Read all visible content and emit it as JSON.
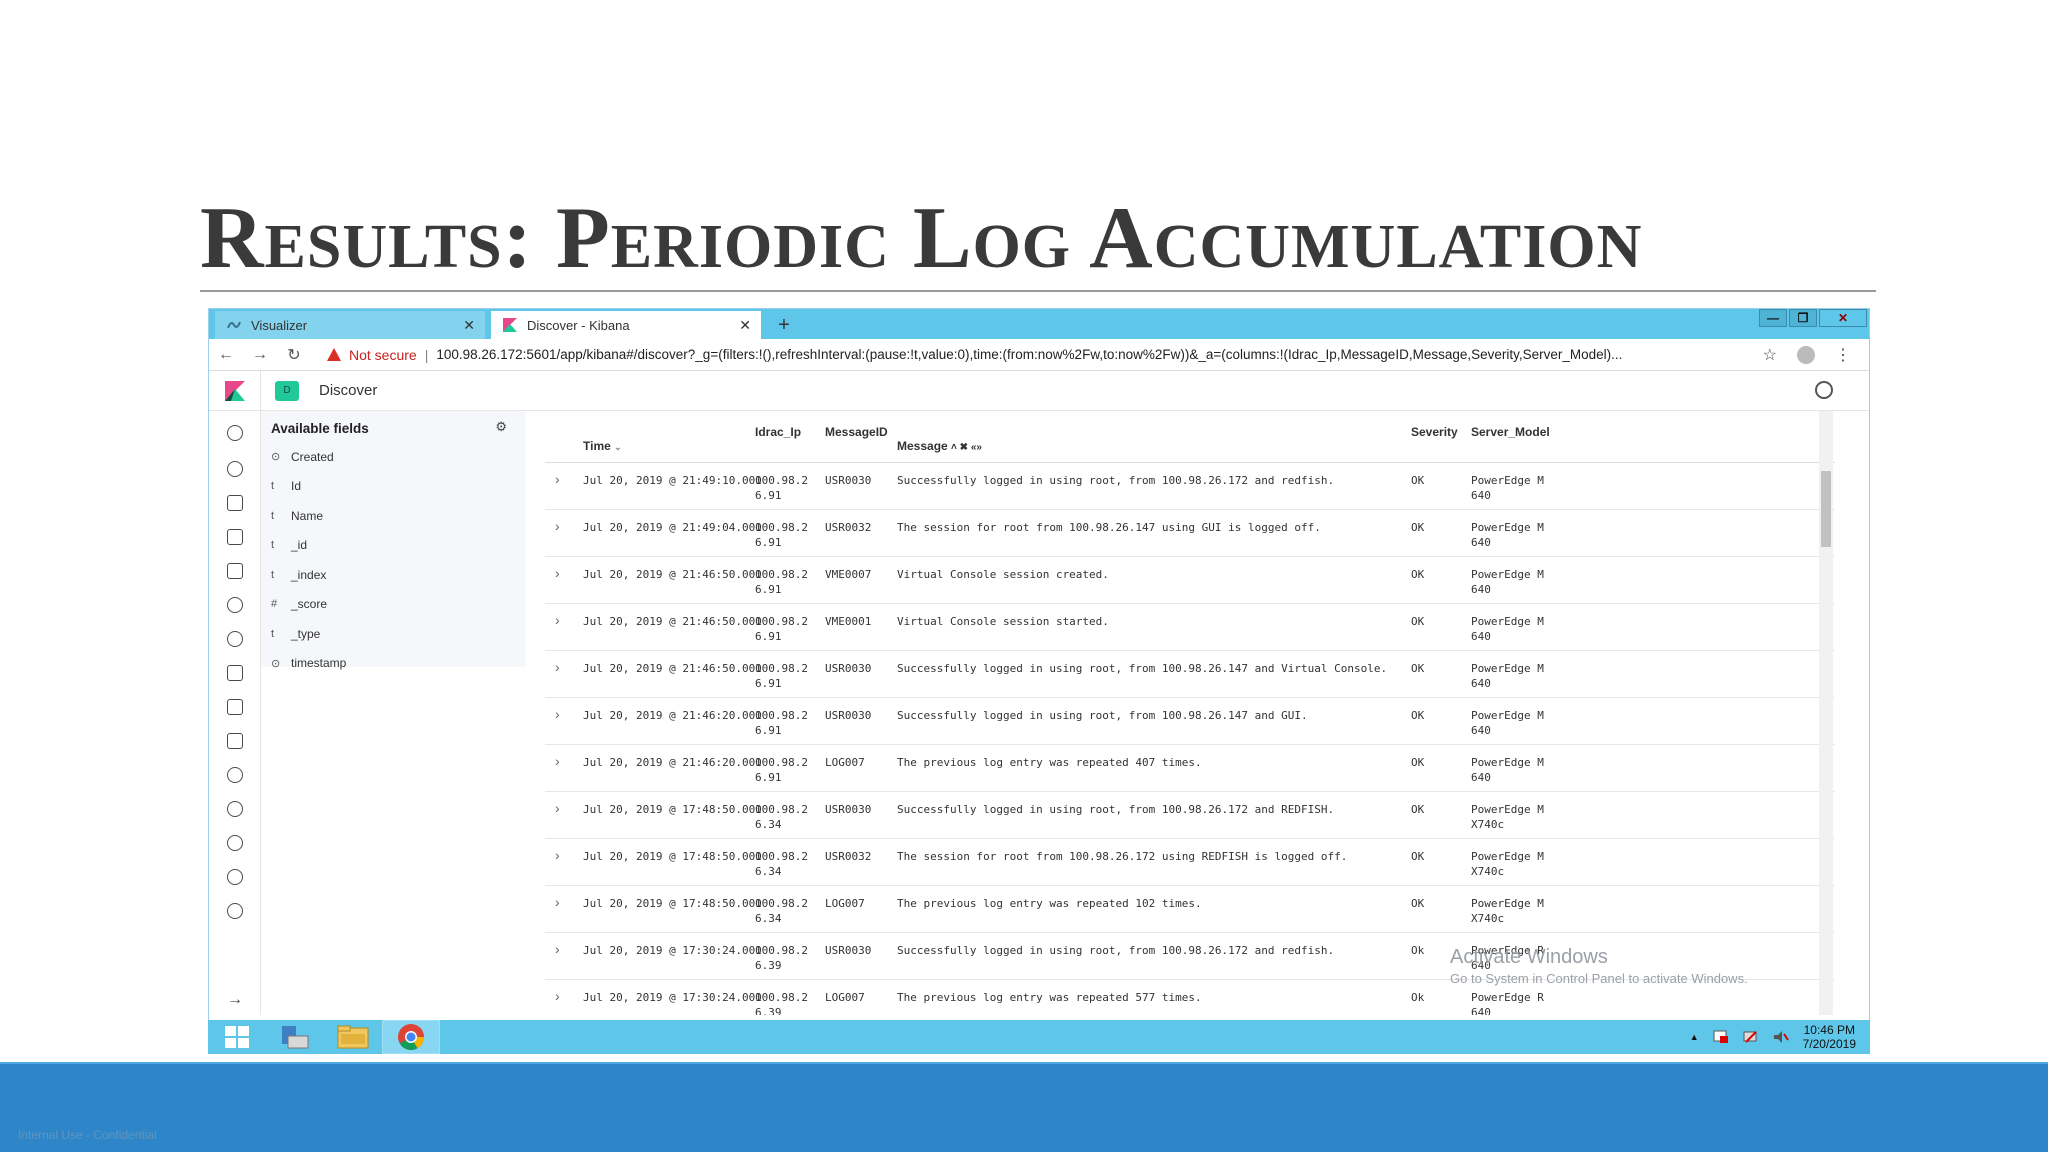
{
  "slide": {
    "title": "Results: Periodic Log Accumulation",
    "footer_note": "Internal Use - Confidential"
  },
  "browser": {
    "tabs": [
      {
        "label": "Visualizer",
        "active": false
      },
      {
        "label": "Discover - Kibana",
        "active": true
      }
    ],
    "new_tab": "+",
    "window_controls": {
      "minimize": "—",
      "restore": "❐",
      "close": "✕"
    },
    "nav": {
      "back": "←",
      "forward": "→",
      "reload": "↻"
    },
    "security_label": "Not secure",
    "separator": "|",
    "url": "100.98.26.172:5601/app/kibana#/discover?_g=(filters:!(),refreshInterval:(pause:!t,value:0),time:(from:now%2Fw,to:now%2Fw))&_a=(columns:!(Idrac_Ip,MessageID,Message,Severity,Server_Model)...",
    "bookmark": "☆",
    "menu": "⋮"
  },
  "kibana": {
    "space_badge": "D",
    "breadcrumb": "Discover",
    "sidebar": {
      "title": "Available fields",
      "gear": "⚙",
      "fields": [
        {
          "type": "⊙",
          "name": "Created"
        },
        {
          "type": "t",
          "name": "Id"
        },
        {
          "type": "t",
          "name": "Name"
        },
        {
          "type": "t",
          "name": "_id"
        },
        {
          "type": "t",
          "name": "_index"
        },
        {
          "type": "#",
          "name": "_score"
        },
        {
          "type": "t",
          "name": "_type"
        },
        {
          "type": "⊙",
          "name": "timestamp"
        }
      ]
    },
    "table": {
      "headers": {
        "time": "Time",
        "idrac_ip": "Idrac_Ip",
        "message_id": "MessageID",
        "message": "Message",
        "message_controls": "˄ ✖ «»",
        "severity": "Severity",
        "server_model": "Server_Model"
      },
      "rows": [
        {
          "time": "Jul 20, 2019 @ 21:49:10.000",
          "ip1": "100.98.2",
          "ip2": "6.91",
          "id": "USR0030",
          "msg": "Successfully logged in using root, from 100.98.26.172 and redfish.",
          "sev": "OK",
          "m1": "PowerEdge M",
          "m2": "640"
        },
        {
          "time": "Jul 20, 2019 @ 21:49:04.000",
          "ip1": "100.98.2",
          "ip2": "6.91",
          "id": "USR0032",
          "msg": "The session for root from 100.98.26.147 using GUI is logged off.",
          "sev": "OK",
          "m1": "PowerEdge M",
          "m2": "640"
        },
        {
          "time": "Jul 20, 2019 @ 21:46:50.000",
          "ip1": "100.98.2",
          "ip2": "6.91",
          "id": "VME0007",
          "msg": "Virtual Console session created.",
          "sev": "OK",
          "m1": "PowerEdge M",
          "m2": "640"
        },
        {
          "time": "Jul 20, 2019 @ 21:46:50.000",
          "ip1": "100.98.2",
          "ip2": "6.91",
          "id": "VME0001",
          "msg": "Virtual Console session started.",
          "sev": "OK",
          "m1": "PowerEdge M",
          "m2": "640"
        },
        {
          "time": "Jul 20, 2019 @ 21:46:50.000",
          "ip1": "100.98.2",
          "ip2": "6.91",
          "id": "USR0030",
          "msg": "Successfully logged in using root, from 100.98.26.147 and Virtual Console.",
          "sev": "OK",
          "m1": "PowerEdge M",
          "m2": "640"
        },
        {
          "time": "Jul 20, 2019 @ 21:46:20.000",
          "ip1": "100.98.2",
          "ip2": "6.91",
          "id": "USR0030",
          "msg": "Successfully logged in using root, from 100.98.26.147 and GUI.",
          "sev": "OK",
          "m1": "PowerEdge M",
          "m2": "640"
        },
        {
          "time": "Jul 20, 2019 @ 21:46:20.000",
          "ip1": "100.98.2",
          "ip2": "6.91",
          "id": "LOG007",
          "msg": "The previous log entry was repeated 407 times.",
          "sev": "OK",
          "m1": "PowerEdge M",
          "m2": "640"
        },
        {
          "time": "Jul 20, 2019 @ 17:48:50.000",
          "ip1": "100.98.2",
          "ip2": "6.34",
          "id": "USR0030",
          "msg": "Successfully logged in using root, from 100.98.26.172 and REDFISH.",
          "sev": "OK",
          "m1": "PowerEdge M",
          "m2": "X740c"
        },
        {
          "time": "Jul 20, 2019 @ 17:48:50.000",
          "ip1": "100.98.2",
          "ip2": "6.34",
          "id": "USR0032",
          "msg": "The session for root from 100.98.26.172 using REDFISH is logged off.",
          "sev": "OK",
          "m1": "PowerEdge M",
          "m2": "X740c"
        },
        {
          "time": "Jul 20, 2019 @ 17:48:50.000",
          "ip1": "100.98.2",
          "ip2": "6.34",
          "id": "LOG007",
          "msg": "The previous log entry was repeated 102 times.",
          "sev": "OK",
          "m1": "PowerEdge M",
          "m2": "X740c"
        },
        {
          "time": "Jul 20, 2019 @ 17:30:24.000",
          "ip1": "100.98.2",
          "ip2": "6.39",
          "id": "USR0030",
          "msg": "Successfully logged in using root, from 100.98.26.172 and redfish.",
          "sev": "Ok",
          "m1": "PowerEdge R",
          "m2": "640"
        },
        {
          "time": "Jul 20, 2019 @ 17:30:24.000",
          "ip1": "100.98.2",
          "ip2": "6.39",
          "id": "LOG007",
          "msg": "The previous log entry was repeated 577 times.",
          "sev": "Ok",
          "m1": "PowerEdge R",
          "m2": "640"
        }
      ]
    },
    "nav_collapse": "→"
  },
  "watermark": {
    "line1": "Activate Windows",
    "line2": "Go to System in Control Panel to activate Windows."
  },
  "taskbar": {
    "tray_arrow": "▲",
    "time": "10:46 PM",
    "date": "7/20/2019"
  },
  "colors": {
    "browser_chrome": "#5ec6e8",
    "kibana_pink": "#e8488b",
    "kibana_teal": "#20c997",
    "slide_footer": "#2e86c8"
  }
}
